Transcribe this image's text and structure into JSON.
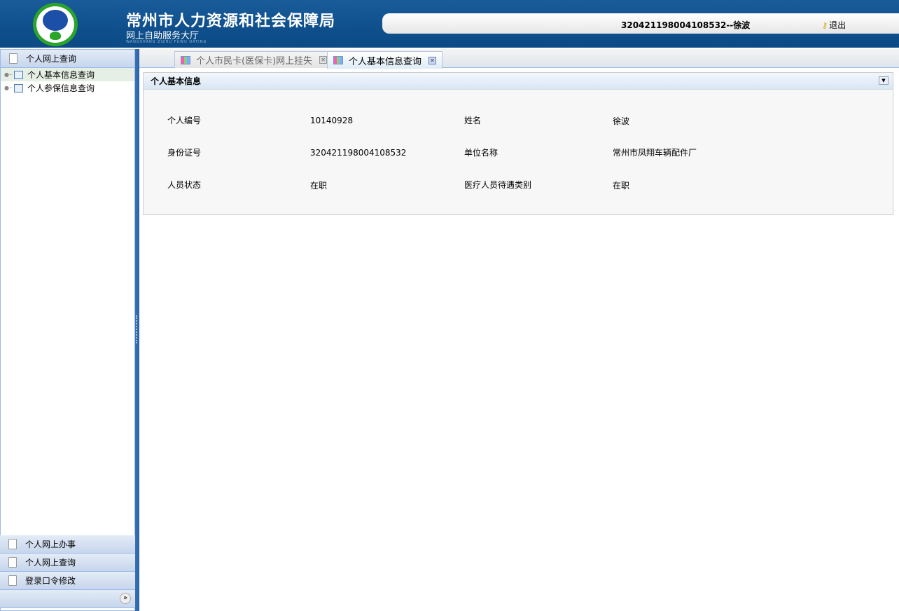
{
  "header": {
    "title": "常州市人力资源和社会保障局",
    "subtitle": "网上自助服务大厅",
    "pinyin": "WANGSHANG ZIZHU FUWU DATING",
    "user": "320421198004108532--徐波",
    "logout": "退出",
    "logo_text": "常州市人力资源和社会保障局"
  },
  "sidebar": {
    "top_section": "个人网上查询",
    "items": [
      {
        "label": "个人基本信息查询"
      },
      {
        "label": "个人参保信息查询"
      }
    ],
    "sections": [
      {
        "label": "个人网上办事"
      },
      {
        "label": "个人网上查询"
      },
      {
        "label": "登录口令修改"
      }
    ]
  },
  "tabs": [
    {
      "label": "个人市民卡(医保卡)网上挂失"
    },
    {
      "label": "个人基本信息查询"
    }
  ],
  "panel": {
    "title": "个人基本信息",
    "fields": [
      {
        "label": "个人编号",
        "value": "10140928"
      },
      {
        "label": "姓名",
        "value": "徐波"
      },
      {
        "label": "身份证号",
        "value": "320421198004108532"
      },
      {
        "label": "单位名称",
        "value": "常州市凤翔车辆配件厂"
      },
      {
        "label": "人员状态",
        "value": "在职"
      },
      {
        "label": "医疗人员待遇类别",
        "value": "在职"
      }
    ]
  }
}
